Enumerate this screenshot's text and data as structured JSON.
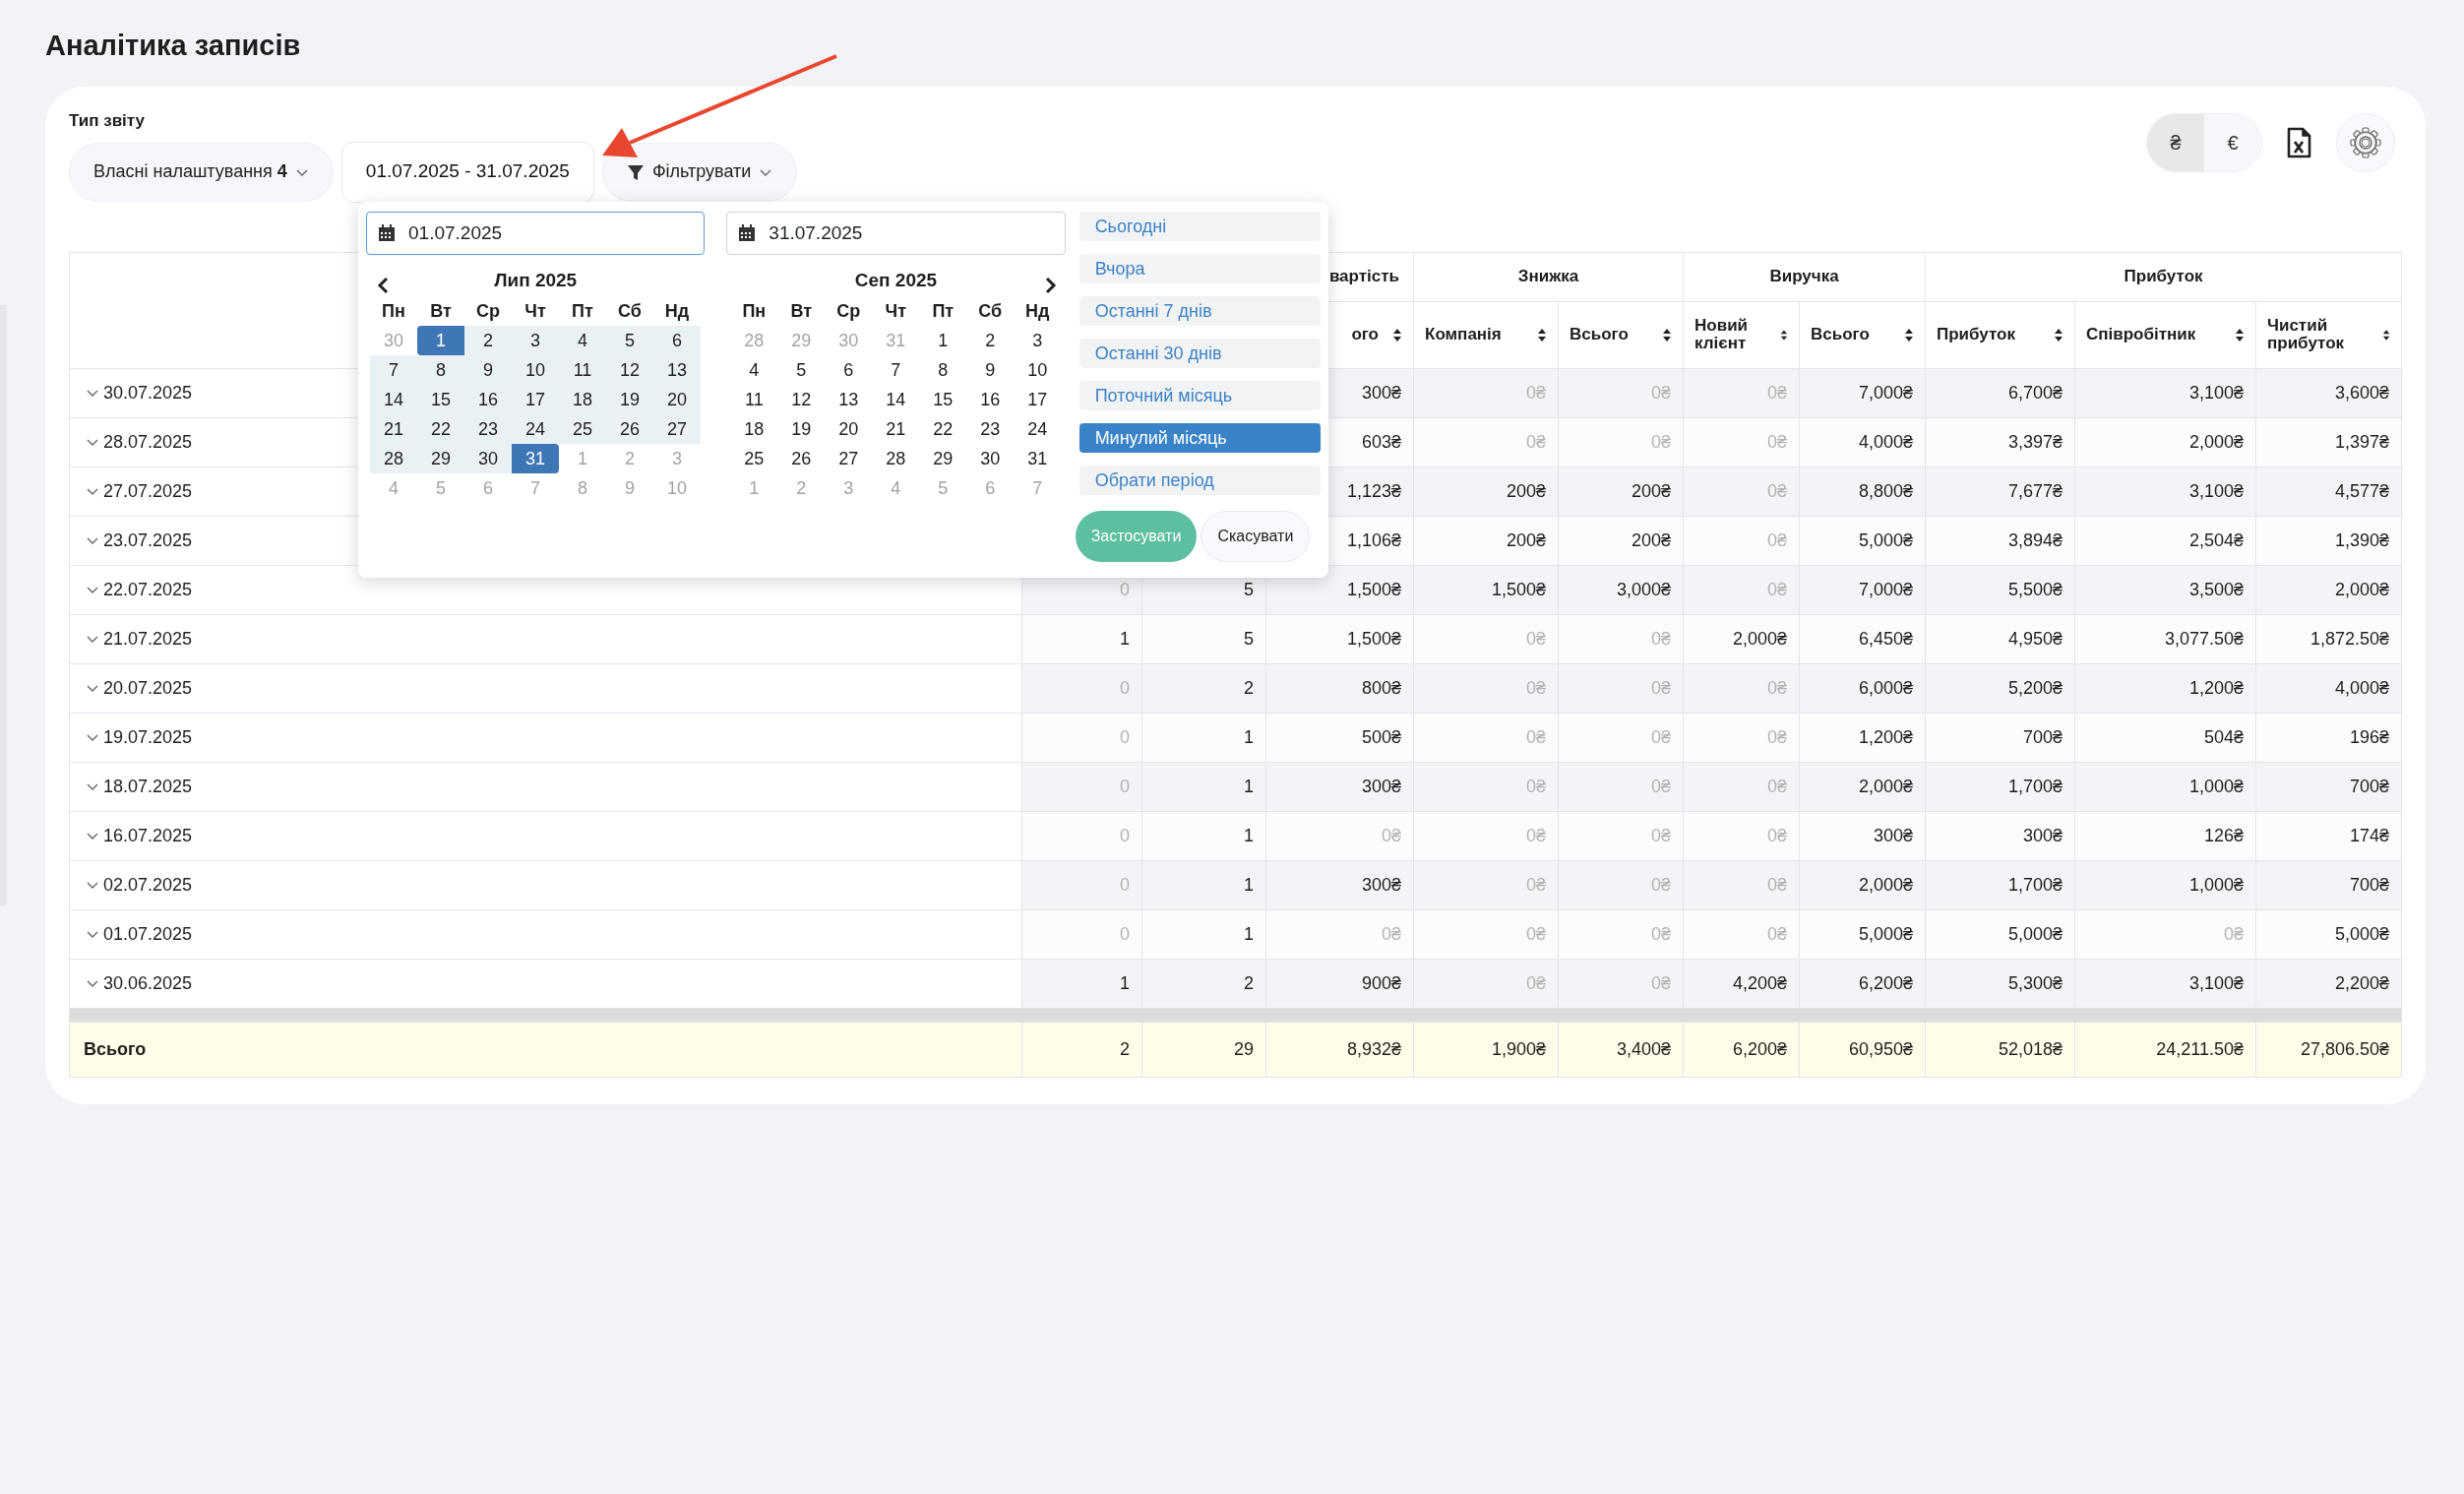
{
  "page": {
    "title": "Аналітика записів"
  },
  "toolbar": {
    "label": "Тип звіту",
    "report_type": {
      "text": "Власні налаштування",
      "count": "4"
    },
    "date_range": "01.07.2025 - 31.07.2025",
    "filter": "Фільтрувати",
    "currencies": [
      {
        "symbol": "₴",
        "selected": true
      },
      {
        "symbol": "€",
        "selected": false
      }
    ]
  },
  "date_picker": {
    "start": "01.07.2025",
    "end": "31.07.2025",
    "months": [
      {
        "title": "Лип 2025",
        "weekdays": [
          "Пн",
          "Вт",
          "Ср",
          "Чт",
          "Пт",
          "Сб",
          "Нд"
        ],
        "days": [
          {
            "d": "30",
            "kind": "other"
          },
          {
            "d": "1",
            "kind": "start"
          },
          {
            "d": "2",
            "kind": "range"
          },
          {
            "d": "3",
            "kind": "range"
          },
          {
            "d": "4",
            "kind": "range"
          },
          {
            "d": "5",
            "kind": "range"
          },
          {
            "d": "6",
            "kind": "range"
          },
          {
            "d": "7",
            "kind": "range"
          },
          {
            "d": "8",
            "kind": "range"
          },
          {
            "d": "9",
            "kind": "range"
          },
          {
            "d": "10",
            "kind": "range"
          },
          {
            "d": "11",
            "kind": "range"
          },
          {
            "d": "12",
            "kind": "range"
          },
          {
            "d": "13",
            "kind": "range"
          },
          {
            "d": "14",
            "kind": "range"
          },
          {
            "d": "15",
            "kind": "range"
          },
          {
            "d": "16",
            "kind": "range"
          },
          {
            "d": "17",
            "kind": "range"
          },
          {
            "d": "18",
            "kind": "range"
          },
          {
            "d": "19",
            "kind": "range"
          },
          {
            "d": "20",
            "kind": "range"
          },
          {
            "d": "21",
            "kind": "range"
          },
          {
            "d": "22",
            "kind": "range"
          },
          {
            "d": "23",
            "kind": "range"
          },
          {
            "d": "24",
            "kind": "range"
          },
          {
            "d": "25",
            "kind": "range"
          },
          {
            "d": "26",
            "kind": "range"
          },
          {
            "d": "27",
            "kind": "range"
          },
          {
            "d": "28",
            "kind": "range"
          },
          {
            "d": "29",
            "kind": "range"
          },
          {
            "d": "30",
            "kind": "range"
          },
          {
            "d": "31",
            "kind": "end"
          },
          {
            "d": "1",
            "kind": "other"
          },
          {
            "d": "2",
            "kind": "other"
          },
          {
            "d": "3",
            "kind": "other"
          },
          {
            "d": "4",
            "kind": "other"
          },
          {
            "d": "5",
            "kind": "other"
          },
          {
            "d": "6",
            "kind": "other"
          },
          {
            "d": "7",
            "kind": "other"
          },
          {
            "d": "8",
            "kind": "other"
          },
          {
            "d": "9",
            "kind": "other"
          },
          {
            "d": "10",
            "kind": "other"
          }
        ]
      },
      {
        "title": "Сеп 2025",
        "weekdays": [
          "Пн",
          "Вт",
          "Ср",
          "Чт",
          "Пт",
          "Сб",
          "Нд"
        ],
        "days": [
          {
            "d": "28",
            "kind": "other"
          },
          {
            "d": "29",
            "kind": "other"
          },
          {
            "d": "30",
            "kind": "other"
          },
          {
            "d": "31",
            "kind": "other"
          },
          {
            "d": "1",
            "kind": "plain"
          },
          {
            "d": "2",
            "kind": "plain"
          },
          {
            "d": "3",
            "kind": "plain"
          },
          {
            "d": "4",
            "kind": "plain"
          },
          {
            "d": "5",
            "kind": "plain"
          },
          {
            "d": "6",
            "kind": "plain"
          },
          {
            "d": "7",
            "kind": "plain"
          },
          {
            "d": "8",
            "kind": "plain"
          },
          {
            "d": "9",
            "kind": "plain"
          },
          {
            "d": "10",
            "kind": "plain"
          },
          {
            "d": "11",
            "kind": "plain"
          },
          {
            "d": "12",
            "kind": "plain"
          },
          {
            "d": "13",
            "kind": "plain"
          },
          {
            "d": "14",
            "kind": "plain"
          },
          {
            "d": "15",
            "kind": "plain"
          },
          {
            "d": "16",
            "kind": "plain"
          },
          {
            "d": "17",
            "kind": "plain"
          },
          {
            "d": "18",
            "kind": "plain"
          },
          {
            "d": "19",
            "kind": "plain"
          },
          {
            "d": "20",
            "kind": "plain"
          },
          {
            "d": "21",
            "kind": "plain"
          },
          {
            "d": "22",
            "kind": "plain"
          },
          {
            "d": "23",
            "kind": "plain"
          },
          {
            "d": "24",
            "kind": "plain"
          },
          {
            "d": "25",
            "kind": "plain"
          },
          {
            "d": "26",
            "kind": "plain"
          },
          {
            "d": "27",
            "kind": "plain"
          },
          {
            "d": "28",
            "kind": "plain"
          },
          {
            "d": "29",
            "kind": "plain"
          },
          {
            "d": "30",
            "kind": "plain"
          },
          {
            "d": "31",
            "kind": "plain"
          },
          {
            "d": "1",
            "kind": "other"
          },
          {
            "d": "2",
            "kind": "other"
          },
          {
            "d": "3",
            "kind": "other"
          },
          {
            "d": "4",
            "kind": "other"
          },
          {
            "d": "5",
            "kind": "other"
          },
          {
            "d": "6",
            "kind": "other"
          },
          {
            "d": "7",
            "kind": "other"
          }
        ]
      }
    ],
    "presets": [
      {
        "label": "Сьогодні",
        "selected": false
      },
      {
        "label": "Вчора",
        "selected": false
      },
      {
        "label": "Останні 7 днів",
        "selected": false
      },
      {
        "label": "Останні 30 днів",
        "selected": false
      },
      {
        "label": "Поточний місяць",
        "selected": false
      },
      {
        "label": "Минулий місяць",
        "selected": true
      },
      {
        "label": "Обрати період",
        "selected": false
      }
    ],
    "apply": "Застосувати",
    "cancel": "Скасувати"
  },
  "table": {
    "groups": [
      {
        "title": "вартість",
        "columns": [
          "ого"
        ]
      },
      {
        "title": "Знижка",
        "columns": [
          "Компанія",
          "Всього"
        ]
      },
      {
        "title": "Виручка",
        "columns": [
          "Новий клієнт",
          "Всього"
        ]
      },
      {
        "title": "Прибуток",
        "columns": [
          "Прибуток",
          "Співробітник",
          "Чистий прибуток"
        ]
      }
    ],
    "rows": [
      {
        "date": "30.07.2025",
        "cells": [
          {
            "v": "300₴",
            "muted": false
          },
          {
            "v": "0₴",
            "muted": true
          },
          {
            "v": "0₴",
            "muted": true
          },
          {
            "v": "0₴",
            "muted": true
          },
          {
            "v": "7,000₴",
            "muted": false
          },
          {
            "v": "6,700₴",
            "muted": false
          },
          {
            "v": "3,100₴",
            "muted": false
          },
          {
            "v": "3,600₴",
            "muted": false
          }
        ]
      },
      {
        "date": "28.07.2025",
        "cells": [
          {
            "v": "603₴",
            "muted": false
          },
          {
            "v": "0₴",
            "muted": true
          },
          {
            "v": "0₴",
            "muted": true
          },
          {
            "v": "0₴",
            "muted": true
          },
          {
            "v": "4,000₴",
            "muted": false
          },
          {
            "v": "3,397₴",
            "muted": false
          },
          {
            "v": "2,000₴",
            "muted": false
          },
          {
            "v": "1,397₴",
            "muted": false
          }
        ]
      },
      {
        "date": "27.07.2025",
        "cells": [
          {
            "v": "1,123₴",
            "muted": false
          },
          {
            "v": "200₴",
            "muted": false
          },
          {
            "v": "200₴",
            "muted": false
          },
          {
            "v": "0₴",
            "muted": true
          },
          {
            "v": "8,800₴",
            "muted": false
          },
          {
            "v": "7,677₴",
            "muted": false
          },
          {
            "v": "3,100₴",
            "muted": false
          },
          {
            "v": "4,577₴",
            "muted": false
          }
        ]
      },
      {
        "date": "23.07.2025",
        "cells": [
          {
            "v": "1,106₴",
            "muted": false
          },
          {
            "v": "200₴",
            "muted": false
          },
          {
            "v": "200₴",
            "muted": false
          },
          {
            "v": "0₴",
            "muted": true
          },
          {
            "v": "5,000₴",
            "muted": false
          },
          {
            "v": "3,894₴",
            "muted": false
          },
          {
            "v": "2,504₴",
            "muted": false
          },
          {
            "v": "1,390₴",
            "muted": false
          }
        ]
      },
      {
        "date": "22.07.2025",
        "cells": [
          {
            "v": "0",
            "muted": true
          },
          {
            "v": "5",
            "muted": false
          },
          {
            "v": "1,500₴",
            "muted": false
          },
          {
            "v": "1,500₴",
            "muted": false
          },
          {
            "v": "3,000₴",
            "muted": false
          },
          {
            "v": "0₴",
            "muted": true
          },
          {
            "v": "7,000₴",
            "muted": false
          },
          {
            "v": "5,500₴",
            "muted": false
          },
          {
            "v": "3,500₴",
            "muted": false
          },
          {
            "v": "2,000₴",
            "muted": false
          }
        ]
      },
      {
        "date": "21.07.2025",
        "cells": [
          {
            "v": "1",
            "muted": false
          },
          {
            "v": "5",
            "muted": false
          },
          {
            "v": "1,500₴",
            "muted": false
          },
          {
            "v": "0₴",
            "muted": true
          },
          {
            "v": "0₴",
            "muted": true
          },
          {
            "v": "2,000₴",
            "muted": false
          },
          {
            "v": "6,450₴",
            "muted": false
          },
          {
            "v": "4,950₴",
            "muted": false
          },
          {
            "v": "3,077.50₴",
            "muted": false
          },
          {
            "v": "1,872.50₴",
            "muted": false
          }
        ]
      },
      {
        "date": "20.07.2025",
        "cells": [
          {
            "v": "0",
            "muted": true
          },
          {
            "v": "2",
            "muted": false
          },
          {
            "v": "800₴",
            "muted": false
          },
          {
            "v": "0₴",
            "muted": true
          },
          {
            "v": "0₴",
            "muted": true
          },
          {
            "v": "0₴",
            "muted": true
          },
          {
            "v": "6,000₴",
            "muted": false
          },
          {
            "v": "5,200₴",
            "muted": false
          },
          {
            "v": "1,200₴",
            "muted": false
          },
          {
            "v": "4,000₴",
            "muted": false
          }
        ]
      },
      {
        "date": "19.07.2025",
        "cells": [
          {
            "v": "0",
            "muted": true
          },
          {
            "v": "1",
            "muted": false
          },
          {
            "v": "500₴",
            "muted": false
          },
          {
            "v": "0₴",
            "muted": true
          },
          {
            "v": "0₴",
            "muted": true
          },
          {
            "v": "0₴",
            "muted": true
          },
          {
            "v": "1,200₴",
            "muted": false
          },
          {
            "v": "700₴",
            "muted": false
          },
          {
            "v": "504₴",
            "muted": false
          },
          {
            "v": "196₴",
            "muted": false
          }
        ]
      },
      {
        "date": "18.07.2025",
        "cells": [
          {
            "v": "0",
            "muted": true
          },
          {
            "v": "1",
            "muted": false
          },
          {
            "v": "300₴",
            "muted": false
          },
          {
            "v": "0₴",
            "muted": true
          },
          {
            "v": "0₴",
            "muted": true
          },
          {
            "v": "0₴",
            "muted": true
          },
          {
            "v": "2,000₴",
            "muted": false
          },
          {
            "v": "1,700₴",
            "muted": false
          },
          {
            "v": "1,000₴",
            "muted": false
          },
          {
            "v": "700₴",
            "muted": false
          }
        ]
      },
      {
        "date": "16.07.2025",
        "cells": [
          {
            "v": "0",
            "muted": true
          },
          {
            "v": "1",
            "muted": false
          },
          {
            "v": "0₴",
            "muted": true
          },
          {
            "v": "0₴",
            "muted": true
          },
          {
            "v": "0₴",
            "muted": true
          },
          {
            "v": "0₴",
            "muted": true
          },
          {
            "v": "300₴",
            "muted": false
          },
          {
            "v": "300₴",
            "muted": false
          },
          {
            "v": "126₴",
            "muted": false
          },
          {
            "v": "174₴",
            "muted": false
          }
        ]
      },
      {
        "date": "02.07.2025",
        "cells": [
          {
            "v": "0",
            "muted": true
          },
          {
            "v": "1",
            "muted": false
          },
          {
            "v": "300₴",
            "muted": false
          },
          {
            "v": "0₴",
            "muted": true
          },
          {
            "v": "0₴",
            "muted": true
          },
          {
            "v": "0₴",
            "muted": true
          },
          {
            "v": "2,000₴",
            "muted": false
          },
          {
            "v": "1,700₴",
            "muted": false
          },
          {
            "v": "1,000₴",
            "muted": false
          },
          {
            "v": "700₴",
            "muted": false
          }
        ]
      },
      {
        "date": "01.07.2025",
        "cells": [
          {
            "v": "0",
            "muted": true
          },
          {
            "v": "1",
            "muted": false
          },
          {
            "v": "0₴",
            "muted": true
          },
          {
            "v": "0₴",
            "muted": true
          },
          {
            "v": "0₴",
            "muted": true
          },
          {
            "v": "0₴",
            "muted": true
          },
          {
            "v": "5,000₴",
            "muted": false
          },
          {
            "v": "5,000₴",
            "muted": false
          },
          {
            "v": "0₴",
            "muted": true
          },
          {
            "v": "5,000₴",
            "muted": false
          }
        ]
      },
      {
        "date": "30.06.2025",
        "cells": [
          {
            "v": "1",
            "muted": false
          },
          {
            "v": "2",
            "muted": false
          },
          {
            "v": "900₴",
            "muted": false
          },
          {
            "v": "0₴",
            "muted": true
          },
          {
            "v": "0₴",
            "muted": true
          },
          {
            "v": "4,200₴",
            "muted": false
          },
          {
            "v": "6,200₴",
            "muted": false
          },
          {
            "v": "5,300₴",
            "muted": false
          },
          {
            "v": "3,100₴",
            "muted": false
          },
          {
            "v": "2,200₴",
            "muted": false
          }
        ]
      }
    ],
    "total": {
      "label": "Всього",
      "cells": [
        "2",
        "29",
        "8,932₴",
        "1,900₴",
        "3,400₴",
        "6,200₴",
        "60,950₴",
        "52,018₴",
        "24,211.50₴",
        "27,806.50₴"
      ]
    }
  }
}
